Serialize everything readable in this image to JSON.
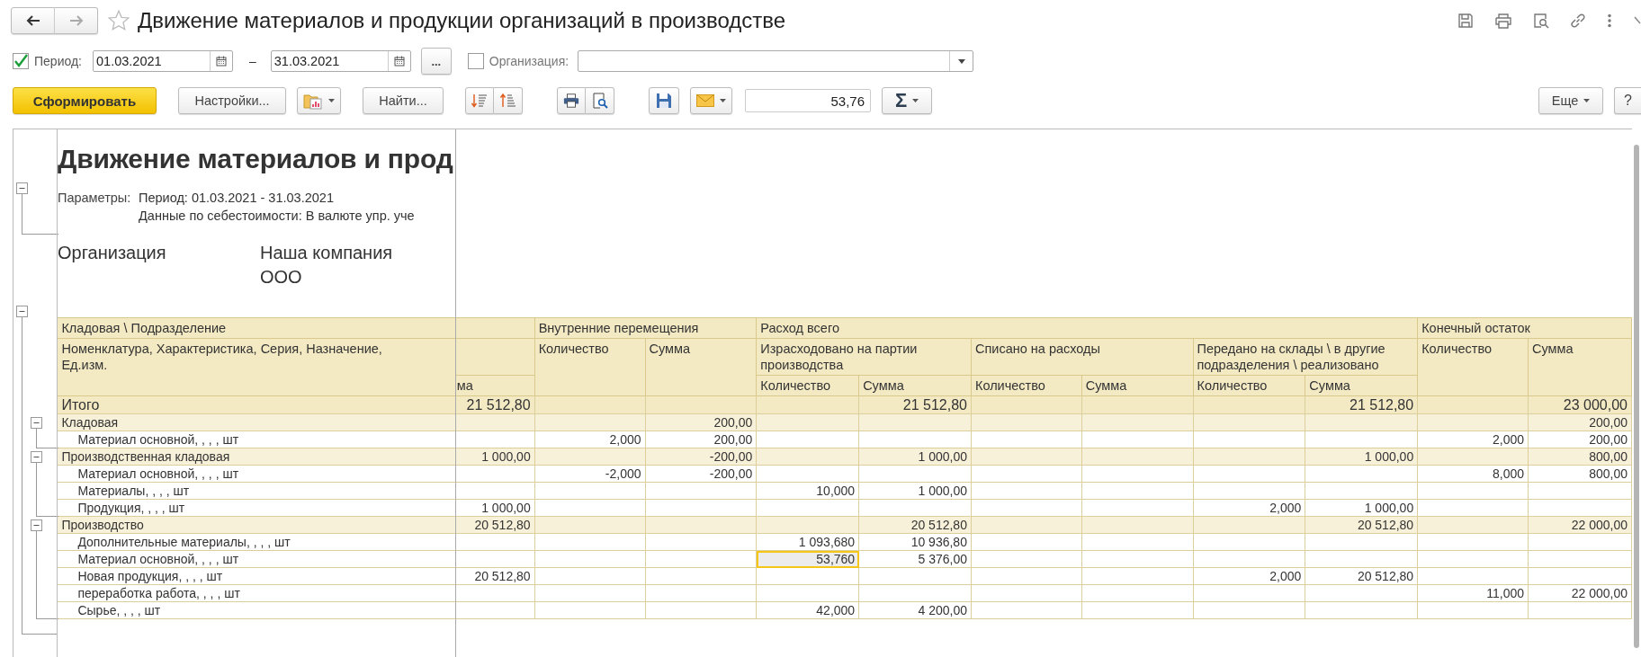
{
  "window": {
    "title": "Движение материалов и продукции организаций в производстве",
    "favorite": false
  },
  "filters": {
    "period_checked": true,
    "period_label": "Период:",
    "date_from": "01.03.2021",
    "dash": "–",
    "date_to": "31.03.2021",
    "more_button": "...",
    "organization_checked": false,
    "organization_label": "Организация:"
  },
  "toolbar": {
    "generate": "Сформировать",
    "settings": "Настройки...",
    "find": "Найти...",
    "value": "53,76",
    "sum_symbol": "Σ",
    "more": "Еще",
    "help": "?"
  },
  "report": {
    "expanded": true,
    "title": "Движение материалов и прод",
    "params_label": "Параметры:",
    "params": [
      "Период: 01.03.2021 - 31.03.2021",
      "Данные по себестоимости: В валюте упр. уче"
    ],
    "organization_label": "Организация",
    "organization_value": [
      "Наша компания",
      "ООО"
    ]
  },
  "table": {
    "expanded": true,
    "header": {
      "row_group": "Кладовая \\ Подразделение",
      "item": "Номенклатура, Характеристика, Серия, Назначение, Ед.изм.",
      "column_2": "ма",
      "groups": [
        {
          "title": "Внутренние перемещения",
          "columns": [
            "Количество",
            "Сумма"
          ]
        },
        {
          "title": "Расход всего",
          "subgroups": [
            {
              "title": "Израсходовано на партии производства",
              "columns": [
                "Количество",
                "Сумма"
              ]
            },
            {
              "title": "Списано на расходы",
              "columns": [
                "Количество",
                "Сумма"
              ]
            },
            {
              "title": "Передано на склады \\ в другие подразделения \\ реализовано",
              "columns": [
                "Количество",
                "Сумма"
              ]
            }
          ]
        },
        {
          "title": "Конечный остаток",
          "columns": [
            "Количество",
            "Сумма"
          ]
        }
      ]
    },
    "rows": [
      {
        "kind": "total",
        "name": "Итого",
        "cells": [
          {
            "text": "21 512,80",
            "selected": false
          },
          null,
          null,
          null,
          {
            "text": "21 512,80",
            "selected": false
          },
          null,
          null,
          null,
          {
            "text": "21 512,80",
            "selected": false
          },
          null,
          {
            "text": "23 000,00",
            "selected": false
          }
        ]
      },
      {
        "kind": "group",
        "name": "Кладовая",
        "expanded": true,
        "cells": [
          null,
          null,
          {
            "text": "200,00",
            "selected": false
          },
          null,
          null,
          null,
          null,
          null,
          null,
          null,
          {
            "text": "200,00",
            "selected": false
          }
        ],
        "children": [
          {
            "kind": "item",
            "name": "Материал основной, , , , шт",
            "cells": [
              null,
              {
                "text": "2,000",
                "selected": false
              },
              {
                "text": "200,00",
                "selected": false
              },
              null,
              null,
              null,
              null,
              null,
              null,
              {
                "text": "2,000",
                "selected": false
              },
              {
                "text": "200,00",
                "selected": false
              }
            ]
          }
        ]
      },
      {
        "kind": "group",
        "name": "Производственная кладовая",
        "expanded": true,
        "cells": [
          {
            "text": "1 000,00",
            "selected": false
          },
          null,
          {
            "text": "-200,00",
            "selected": false
          },
          null,
          {
            "text": "1 000,00",
            "selected": false
          },
          null,
          null,
          null,
          {
            "text": "1 000,00",
            "selected": false
          },
          null,
          {
            "text": "800,00",
            "selected": false
          }
        ],
        "children": [
          {
            "kind": "item",
            "name": "Материал основной, , , , шт",
            "cells": [
              null,
              {
                "text": "-2,000",
                "selected": false
              },
              {
                "text": "-200,00",
                "selected": false
              },
              null,
              null,
              null,
              null,
              null,
              null,
              {
                "text": "8,000",
                "selected": false
              },
              {
                "text": "800,00",
                "selected": false
              }
            ]
          },
          {
            "kind": "item",
            "name": "Материалы, , , , шт",
            "cells": [
              null,
              null,
              null,
              {
                "text": "10,000",
                "selected": false
              },
              {
                "text": "1 000,00",
                "selected": false
              },
              null,
              null,
              null,
              null,
              null,
              null
            ]
          },
          {
            "kind": "item",
            "name": "Продукция, , , , шт",
            "cells": [
              {
                "text": "1 000,00",
                "selected": false
              },
              null,
              null,
              null,
              null,
              null,
              null,
              {
                "text": "2,000",
                "selected": false
              },
              {
                "text": "1 000,00",
                "selected": false
              },
              null,
              null
            ]
          }
        ]
      },
      {
        "kind": "group",
        "name": "Производство",
        "expanded": true,
        "cells": [
          {
            "text": "20 512,80",
            "selected": false
          },
          null,
          null,
          null,
          {
            "text": "20 512,80",
            "selected": false
          },
          null,
          null,
          null,
          {
            "text": "20 512,80",
            "selected": false
          },
          null,
          {
            "text": "22 000,00",
            "selected": false
          }
        ],
        "children": [
          {
            "kind": "item",
            "name": "Дополнительные материалы, , , , шт",
            "cells": [
              null,
              null,
              null,
              {
                "text": "1 093,680",
                "selected": false
              },
              {
                "text": "10 936,80",
                "selected": false
              },
              null,
              null,
              null,
              null,
              null,
              null
            ]
          },
          {
            "kind": "item",
            "name": "Материал основной, , , , шт",
            "cells": [
              null,
              null,
              null,
              {
                "text": "53,760",
                "selected": true
              },
              {
                "text": "5 376,00",
                "selected": false
              },
              null,
              null,
              null,
              null,
              null,
              null
            ]
          },
          {
            "kind": "item",
            "name": "Новая продукция, , , , шт",
            "cells": [
              {
                "text": "20 512,80",
                "selected": false
              },
              null,
              null,
              null,
              null,
              null,
              null,
              {
                "text": "2,000",
                "selected": false
              },
              {
                "text": "20 512,80",
                "selected": false
              },
              null,
              null
            ]
          },
          {
            "kind": "item",
            "name": "переработка работа, , , , шт",
            "cells": [
              null,
              null,
              null,
              null,
              null,
              null,
              null,
              null,
              null,
              {
                "text": "11,000",
                "selected": false
              },
              {
                "text": "22 000,00",
                "selected": false
              }
            ]
          },
          {
            "kind": "item",
            "name": "Сырье, , , , шт",
            "cells": [
              null,
              null,
              null,
              {
                "text": "42,000",
                "selected": false
              },
              {
                "text": "4 200,00",
                "selected": false
              },
              null,
              null,
              null,
              null,
              null,
              null
            ]
          }
        ]
      }
    ]
  }
}
